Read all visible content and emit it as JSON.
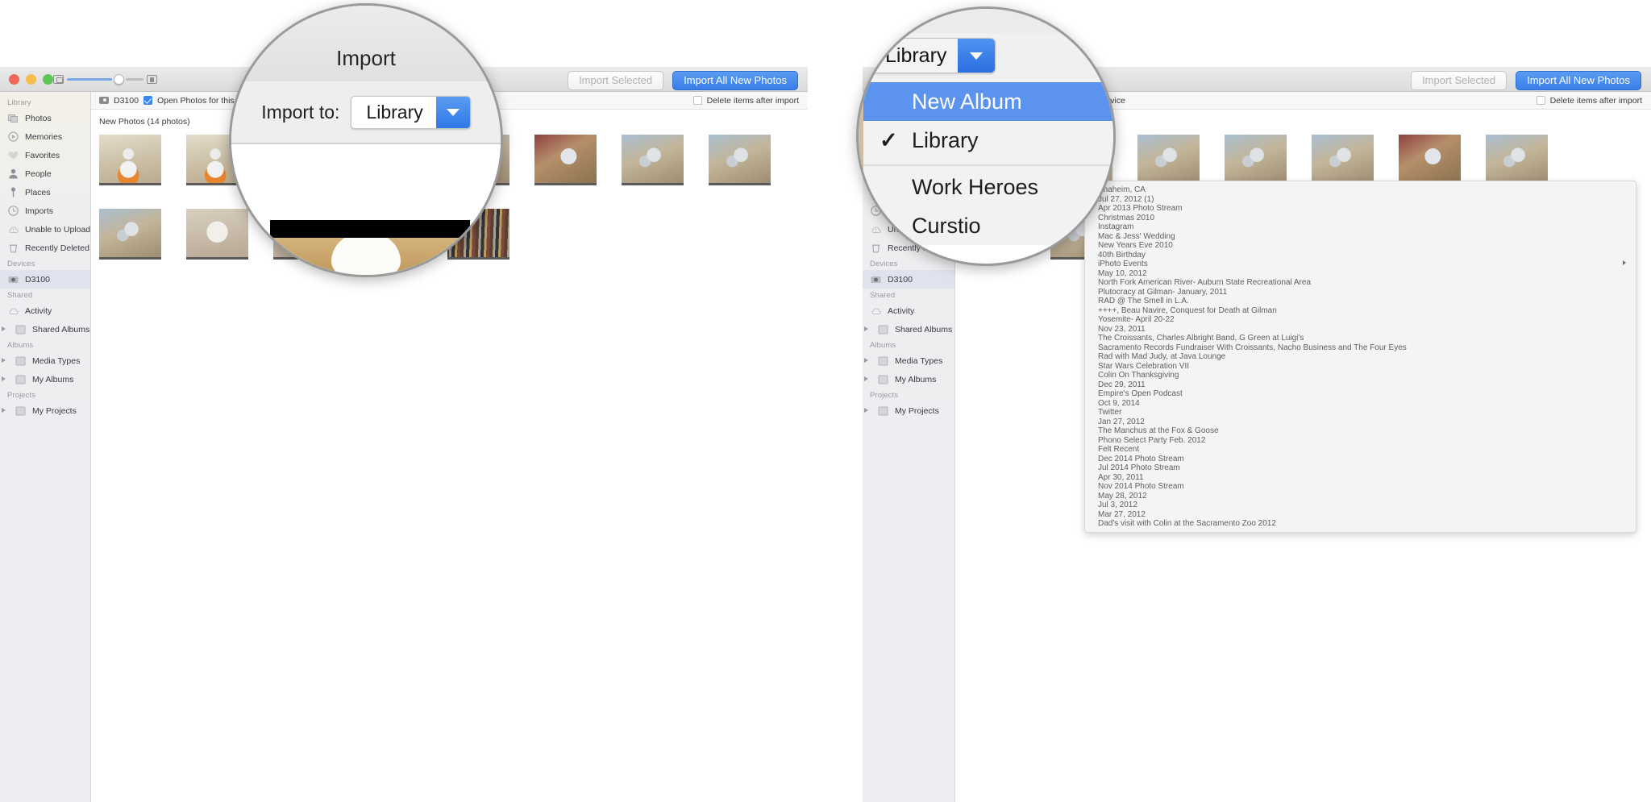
{
  "app": {
    "name": "Photos Import"
  },
  "sidebar": {
    "sections": [
      {
        "header": "Library",
        "items": [
          {
            "label": "Photos",
            "icon": "photos-icon"
          },
          {
            "label": "Memories",
            "icon": "memories-icon"
          },
          {
            "label": "Favorites",
            "icon": "heart-icon"
          },
          {
            "label": "People",
            "icon": "person-icon"
          },
          {
            "label": "Places",
            "icon": "pin-icon"
          },
          {
            "label": "Imports",
            "icon": "clock-icon"
          },
          {
            "label": "Unable to Upload",
            "icon": "cloud-warning-icon"
          },
          {
            "label": "Recently Deleted",
            "icon": "trash-icon"
          }
        ]
      },
      {
        "header": "Devices",
        "items": [
          {
            "label": "D3100",
            "icon": "camera-icon",
            "selected": true
          }
        ]
      },
      {
        "header": "Shared",
        "items": [
          {
            "label": "Activity",
            "icon": "cloud-icon"
          },
          {
            "label": "Shared Albums",
            "icon": "folder-icon",
            "disclosure": true
          }
        ]
      },
      {
        "header": "Albums",
        "items": [
          {
            "label": "Media Types",
            "icon": "folder-icon",
            "disclosure": true
          },
          {
            "label": "My Albums",
            "icon": "folder-icon",
            "disclosure": true
          }
        ]
      },
      {
        "header": "Projects",
        "items": [
          {
            "label": "My Projects",
            "icon": "folder-icon",
            "disclosure": true
          }
        ]
      }
    ]
  },
  "toolbar": {
    "import_selected_label": "Import Selected",
    "import_all_label": "Import All New Photos",
    "accent_color": "#3a7ee8"
  },
  "device_bar": {
    "device_name": "D3100",
    "open_photos_label": "Open Photos for this device",
    "open_photos_checked": true,
    "delete_after_label": "Delete items after import",
    "delete_after_checked": false
  },
  "content": {
    "section_title": "New Photos (14 photos)",
    "thumbnails": [
      {
        "alt": "bb8-droid",
        "art": "t-bb8"
      },
      {
        "alt": "bb8-droid",
        "art": "t-bb8"
      },
      {
        "alt": "robot-toy",
        "art": "t-robot"
      },
      {
        "alt": "robot-toy",
        "art": "t-robot"
      },
      {
        "alt": "robot-toy",
        "art": "t-robot"
      },
      {
        "alt": "figure-red",
        "art": "t-fig"
      },
      {
        "alt": "robot-desk",
        "art": "t-robot"
      },
      {
        "alt": "robot-desk",
        "art": "t-robot"
      },
      {
        "alt": "robot-desk",
        "art": "t-robot"
      },
      {
        "alt": "skull-mug",
        "art": "t-skull"
      },
      {
        "alt": "skull-mug",
        "art": "t-skull"
      },
      {
        "alt": "bookshelf",
        "art": "t-books"
      },
      {
        "alt": "bookshelf",
        "art": "t-books"
      }
    ]
  },
  "magnifier_left": {
    "sheet_title": "Import",
    "import_to_label": "Import to:",
    "import_to_value": "Library",
    "chevron": "chevron-down-icon"
  },
  "magnifier_right": {
    "popup_value": "Library",
    "chevron": "chevron-down-icon",
    "menu_items": [
      {
        "label": "New Album",
        "selected": true,
        "checked": false
      },
      {
        "label": "Library",
        "selected": false,
        "checked": true
      }
    ],
    "menu_items_after_separator": [
      {
        "label": "Work Heroes"
      },
      {
        "label": "Curstio"
      }
    ]
  },
  "album_list": {
    "rows": [
      {
        "label": "Anaheim, CA"
      },
      {
        "label": "Jul 27, 2012 (1)"
      },
      {
        "label": "Apr 2013 Photo Stream"
      },
      {
        "label": "Christmas 2010"
      },
      {
        "label": "Instagram"
      },
      {
        "label": "Mac & Jess' Wedding"
      },
      {
        "label": "New Years Eve 2010"
      },
      {
        "label": "40th Birthday"
      },
      {
        "label": "iPhoto Events",
        "submenu": true
      },
      {
        "label": "May 10, 2012"
      },
      {
        "label": "North Fork American River- Auburn State Recreational Area"
      },
      {
        "label": "Plutocracy at Gilman- January, 2011"
      },
      {
        "label": "RAD @ The Smell in L.A."
      },
      {
        "label": "++++, Beau Navire, Conquest for Death at Gilman"
      },
      {
        "label": "Yosemite- April 20-22"
      },
      {
        "label": "Nov 23, 2011"
      },
      {
        "label": "The Croissants, Charles Albright Band, G Green at Luigi's"
      },
      {
        "label": "Sacramento Records Fundraiser With Croissants, Nacho Business and The Four Eyes"
      },
      {
        "label": "Rad with Mad Judy, at Java Lounge"
      },
      {
        "label": "Star Wars Celebration VII"
      },
      {
        "label": "Colin On Thanksgiving"
      },
      {
        "label": "Dec 29, 2011"
      },
      {
        "label": "Empire's Open Podcast"
      },
      {
        "label": "Oct 9, 2014"
      },
      {
        "label": "Twitter"
      },
      {
        "label": "Jan 27, 2012"
      },
      {
        "label": "The Manchus at the Fox & Goose"
      },
      {
        "label": "Phono Select Party Feb. 2012"
      },
      {
        "label": "Felt Recent"
      },
      {
        "label": "Dec 2014 Photo Stream"
      },
      {
        "label": "Jul 2014 Photo Stream"
      },
      {
        "label": "Apr 30, 2011"
      },
      {
        "label": "Nov 2014 Photo Stream"
      },
      {
        "label": "May 28, 2012"
      },
      {
        "label": "Jul 3, 2012"
      },
      {
        "label": "Mar 27, 2012"
      },
      {
        "label": "Dad's visit with Colin at the Sacramento Zoo 2012"
      }
    ]
  }
}
